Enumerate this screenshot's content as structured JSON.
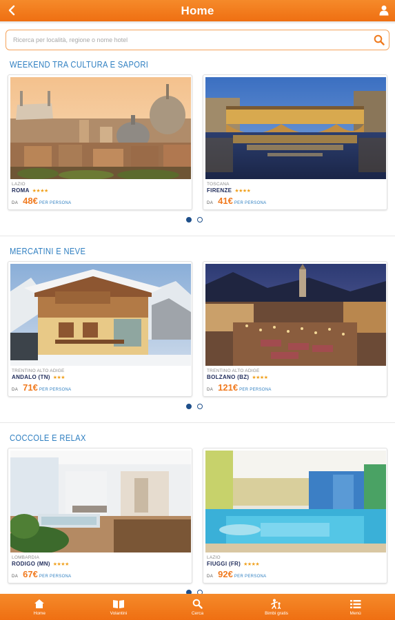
{
  "header": {
    "title": "Home",
    "back_icon": "back-arrow-icon",
    "user_icon": "user-icon"
  },
  "search": {
    "placeholder": "Ricerca per località, regione o nome hotel",
    "value": "",
    "icon": "search-icon"
  },
  "sections": [
    {
      "title": "WEEKEND TRA CULTURA E SAPORI",
      "cards": [
        {
          "region": "LAZIO",
          "city": "ROMA",
          "stars": "★★★★",
          "da": "DA",
          "price": "48€",
          "per": "PER PERSONA",
          "image": "rome-skyline"
        },
        {
          "region": "TOSCANA",
          "city": "FIRENZE",
          "stars": "★★★★",
          "da": "DA",
          "price": "41€",
          "per": "PER PERSONA",
          "image": "florence-ponte-vecchio"
        }
      ],
      "pager": {
        "count": 2,
        "active": 0
      }
    },
    {
      "title": "MERCATINI E NEVE",
      "cards": [
        {
          "region": "TRENTINO ALTO ADIGE",
          "city": "ANDALO (TN)",
          "stars": "★★★",
          "da": "DA",
          "price": "71€",
          "per": "PER PERSONA",
          "image": "alpine-chalet"
        },
        {
          "region": "TRENTINO ALTO ADIGE",
          "city": "BOLZANO (BZ)",
          "stars": "★★★★",
          "da": "DA",
          "price": "121€",
          "per": "PER PERSONA",
          "image": "christmas-market"
        }
      ],
      "pager": {
        "count": 2,
        "active": 0
      }
    },
    {
      "title": "COCCOLE E RELAX",
      "cards": [
        {
          "region": "LOMBARDIA",
          "city": "RODIGO (MN)",
          "stars": "★★★★",
          "da": "DA",
          "price": "67€",
          "per": "PER PERSONA",
          "image": "spa-lounge"
        },
        {
          "region": "LAZIO",
          "city": "FIUGGI (FR)",
          "stars": "★★★★",
          "da": "DA",
          "price": "92€",
          "per": "PER PERSONA",
          "image": "indoor-pool"
        }
      ],
      "pager": {
        "count": 2,
        "active": 0
      }
    }
  ],
  "bottom_nav": [
    {
      "label": "Home",
      "icon": "home-icon"
    },
    {
      "label": "Volantini",
      "icon": "book-icon"
    },
    {
      "label": "Cerca",
      "icon": "search-icon"
    },
    {
      "label": "Bimbi gratis",
      "icon": "family-icon"
    },
    {
      "label": "Menù",
      "icon": "menu-list-icon"
    }
  ],
  "colors": {
    "accent": "#f07a1f",
    "title_blue": "#2f7fc1",
    "dot_blue": "#1e4f8a",
    "star": "#f0a01c"
  }
}
